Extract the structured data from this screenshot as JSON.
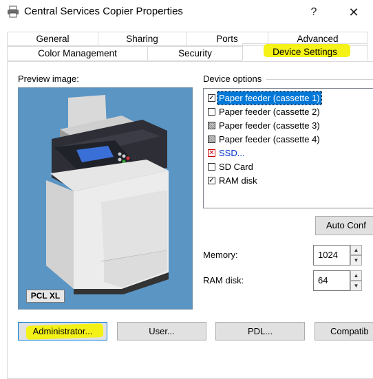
{
  "window": {
    "title": "Central Services Copier Properties",
    "help_glyph": "?",
    "close_glyph": "✕"
  },
  "tabs_row1": [
    "General",
    "Sharing",
    "Ports",
    "Advanced"
  ],
  "tabs_row2": [
    "Color Management",
    "Security",
    "Device Settings"
  ],
  "active_tab": "Device Settings",
  "preview": {
    "label": "Preview image:",
    "badge": "PCL XL"
  },
  "device_options": {
    "label": "Device options",
    "items": [
      {
        "label": "Paper feeder (cassette 1)",
        "state": "checked",
        "selected": true
      },
      {
        "label": "Paper feeder (cassette 2)",
        "state": "unchecked"
      },
      {
        "label": "Paper feeder (cassette 3)",
        "state": "indeterminate"
      },
      {
        "label": "Paper feeder (cassette 4)",
        "state": "indeterminate"
      },
      {
        "label": "SSD...",
        "state": "error"
      },
      {
        "label": "SD Card",
        "state": "unchecked"
      },
      {
        "label": "RAM disk",
        "state": "checked"
      }
    ]
  },
  "auto_config_label": "Auto Conf",
  "memory": {
    "label": "Memory:",
    "value": "1024"
  },
  "ram_disk": {
    "label": "RAM disk:",
    "value": "64"
  },
  "bottom_buttons": [
    "Administrator...",
    "User...",
    "PDL...",
    "Compatib"
  ],
  "colors": {
    "highlight": "#f3f10a",
    "selection": "#0078d7",
    "preview_bg": "#5a95c4"
  }
}
